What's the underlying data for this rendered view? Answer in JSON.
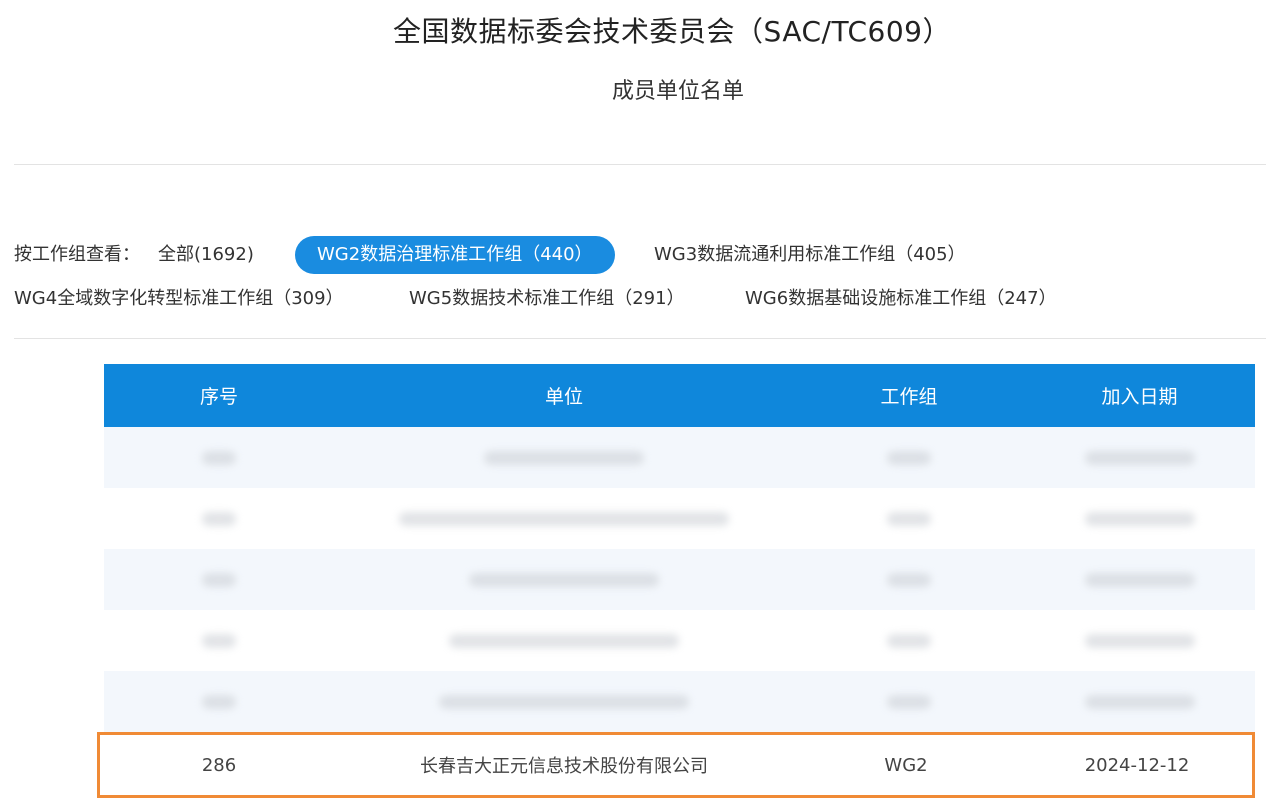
{
  "page": {
    "title": "全国数据标委会技术委员会（SAC/TC609）",
    "subtitle": "成员单位名单"
  },
  "filters": {
    "label": "按工作组查看：",
    "row1": [
      {
        "text": "全部(1692)",
        "active": false
      },
      {
        "text": "WG2数据治理标准工作组（440）",
        "active": true
      },
      {
        "text": "WG3数据流通利用标准工作组（405）",
        "active": false
      }
    ],
    "row2": [
      {
        "text": "WG4全域数字化转型标准工作组（309）",
        "active": false
      },
      {
        "text": "WG5数据技术标准工作组（291）",
        "active": false
      },
      {
        "text": "WG6数据基础设施标准工作组（247）",
        "active": false
      }
    ]
  },
  "table": {
    "headers": [
      "序号",
      "单位",
      "工作组",
      "加入日期"
    ],
    "highlighted_row": {
      "seq": "286",
      "unit": "长春吉大正元信息技术股份有限公司",
      "wg": "WG2",
      "date": "2024-12-12"
    }
  },
  "colors": {
    "header_bg": "#0f87db",
    "active_pill": "#1a8ce0",
    "highlight_border": "#f08a35",
    "row_alt_bg": "#f3f7fc"
  }
}
